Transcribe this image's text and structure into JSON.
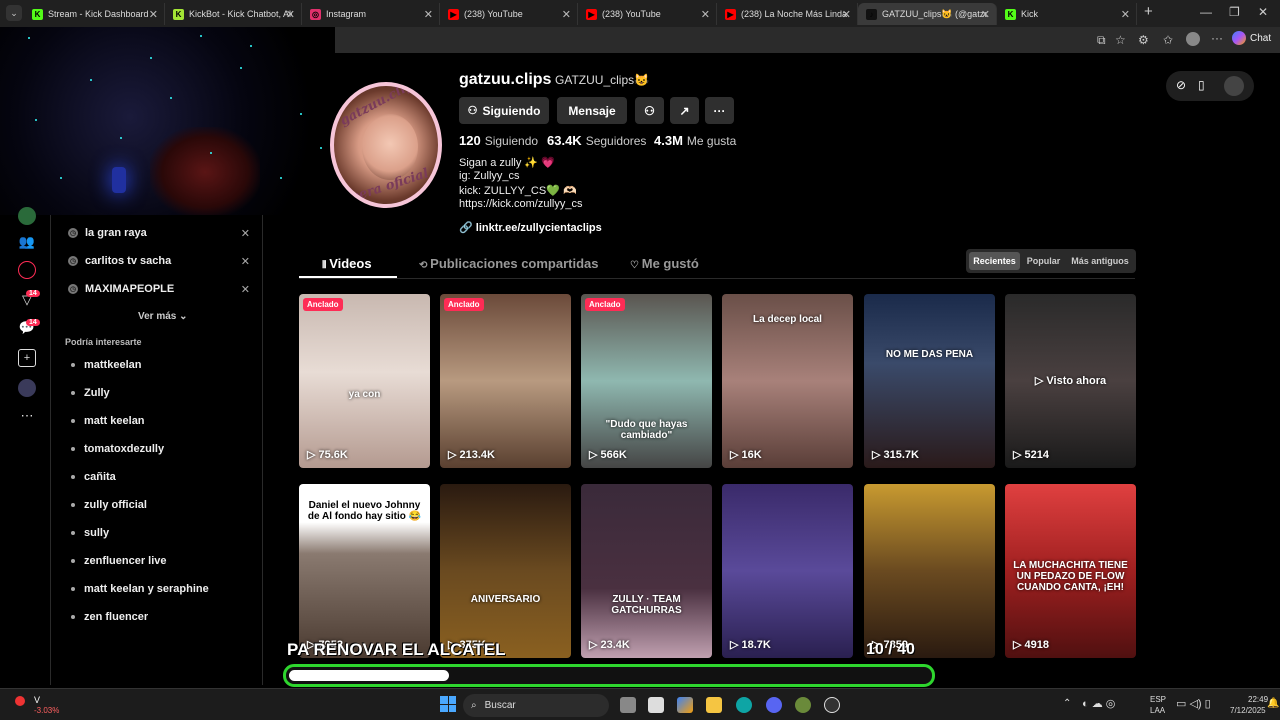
{
  "browser": {
    "tabs": [
      {
        "title": "Stream - Kick Dashboard",
        "fav": "K",
        "fav_color": "#53fc18"
      },
      {
        "title": "KickBot - Kick Chatbot, Alerts",
        "fav": "K",
        "fav_color": "#a3e635"
      },
      {
        "title": "Instagram",
        "fav": "◎",
        "fav_color": "#e1306c"
      },
      {
        "title": "(238) YouTube",
        "fav": "▶",
        "fav_color": "#ff0000"
      },
      {
        "title": "(238) YouTube",
        "fav": "▶",
        "fav_color": "#ff0000"
      },
      {
        "title": "(238) La Noche Más Linda -",
        "fav": "▶",
        "fav_color": "#ff0000"
      },
      {
        "title": "GATZUU_clips😺 (@gatzuu",
        "fav": "♪",
        "fav_color": "#111111"
      },
      {
        "title": "Kick",
        "fav": "K",
        "fav_color": "#53fc18"
      }
    ],
    "new_tab_label": "+",
    "chat_label": "Chat"
  },
  "rail": {
    "badge_inbox": "14",
    "badge_messages": "14"
  },
  "sidebar": {
    "history": [
      {
        "label": "la gran raya"
      },
      {
        "label": "carlitos tv sacha"
      },
      {
        "label": "MAXIMAPEOPLE"
      }
    ],
    "see_more": "Ver más",
    "suggest_heading": "Podría interesarte",
    "suggestions": [
      "mattkeelan",
      "Zully",
      "matt keelan",
      "tomatoxdezully",
      "cañita",
      "zully official",
      "sully",
      "zenfluencer live",
      "matt keelan y seraphine",
      "zen fluencer"
    ]
  },
  "profile": {
    "username": "gatzuu.clips",
    "nickname": "GATZUU_clips😺",
    "avatar_text_top": "gatzuu.clips",
    "avatar_text_bottom": "tipera oficial",
    "follow_label": "Siguiendo",
    "message_label": "Mensaje",
    "following_count": "120",
    "following_label": "Siguiendo",
    "followers_count": "63.4K",
    "followers_label": "Seguidores",
    "likes_count": "4.3M",
    "likes_label": "Me gusta",
    "bio": [
      "Sigan a zully ✨ 💗",
      "ig: Zullyy_cs",
      "kick: ZULLYY_CS💚 🫶🏻",
      "https://kick.com/zullyy_cs"
    ],
    "link": "linktr.ee/zullycientaclips"
  },
  "tabs": {
    "videos": "Videos",
    "reposts": "Publicaciones compartidas",
    "liked": "Me gustó"
  },
  "sort": {
    "recent": "Recientes",
    "popular": "Popular",
    "oldest": "Más antiguos"
  },
  "videos_row1": [
    {
      "views": "75.6K",
      "pinned": "Anclado",
      "caption": "ya con",
      "bg": "linear-gradient(180deg,#c8b8b0 0%,#e8dcd5 45%,#b49a90 100%)"
    },
    {
      "views": "213.4K",
      "pinned": "Anclado",
      "caption": "",
      "bg": "linear-gradient(180deg,#6b4a3a 0%,#b89a80 50%,#5a4030 100%)"
    },
    {
      "views": "566K",
      "pinned": "Anclado",
      "caption": "\"Dudo que hayas cambiado\"",
      "bg": "linear-gradient(180deg,#5a5550 0%,#8fb8b0 50%,#454545 100%)"
    },
    {
      "views": "16K",
      "pinned": "",
      "caption": "La decep local",
      "bg": "linear-gradient(180deg,#6a4f48 0%,#a8817a 50%,#5a3e38 100%)"
    },
    {
      "views": "315.7K",
      "pinned": "",
      "caption": "NO ME DAS PENA",
      "bg": "linear-gradient(180deg,#1a2a4a 0%,#3a4a6a 40%,#2a1a1a 100%)"
    },
    {
      "views": "5214",
      "pinned": "",
      "caption": "",
      "watch_now": "Visto ahora",
      "bg": "linear-gradient(180deg,#2a2a2a 0%,#4a4040 50%,#1a1a1a 100%)"
    }
  ],
  "videos_row2": [
    {
      "views": "7952",
      "caption": "Daniel el nuevo Johnny de Al fondo hay sitio 😂",
      "bg": "linear-gradient(180deg,#ffffff 0%,#ffffff 22%,#8a7a70 40%,#4a3a30 100%)"
    },
    {
      "views": "375K",
      "caption": "ANIVERSARIO",
      "bg": "linear-gradient(180deg,#2a1a10 0%,#6a4a20 50%,#8a6020 100%)"
    },
    {
      "views": "23.4K",
      "caption": "ZULLY · TEAM GATCHURRAS",
      "bg": "linear-gradient(180deg,#3a2a3a 0%,#4a3040 60%,#c0a0b0 100%)"
    },
    {
      "views": "18.7K",
      "caption": "",
      "bg": "linear-gradient(180deg,#3a2a6a 0%,#5a4a9a 50%,#2a2050 100%)"
    },
    {
      "views": "7859",
      "caption": "",
      "bg": "linear-gradient(180deg,#c89a30 0%,#6a4a20 50%,#2a1a10 100%)"
    },
    {
      "views": "4918",
      "caption": "LA MUCHACHITA TIENE UN PEDAZO DE FLOW CUANDO CANTA, ¡EH!",
      "bg": "linear-gradient(180deg,#e04040 0%,#a02020 50%,#501010 100%)"
    }
  ],
  "overlay": {
    "title": "PA RENOVAR EL ALCATEL",
    "counter": "10 / 40",
    "progress_fraction": 0.25
  },
  "taskbar": {
    "search_label": "Buscar",
    "stock_symbol": "V",
    "stock_change": "-3.03%",
    "lang_top": "ESP",
    "lang_bottom": "LAA",
    "time": "22:49",
    "date": "7/12/2025"
  }
}
